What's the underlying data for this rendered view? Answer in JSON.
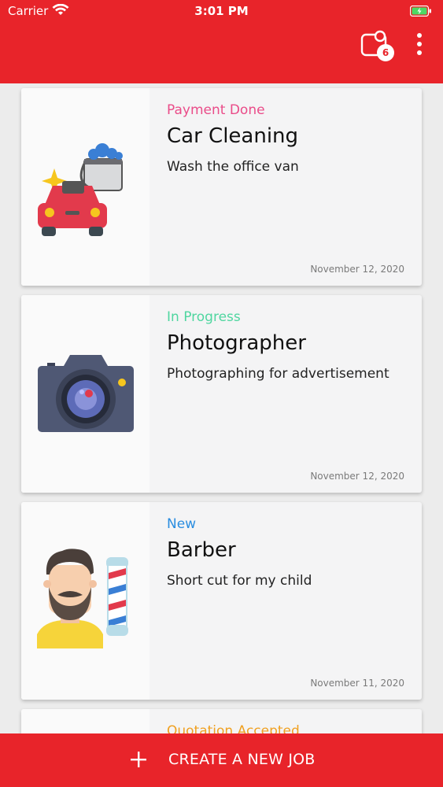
{
  "status_bar": {
    "carrier": "Carrier",
    "time": "3:01 PM"
  },
  "header": {
    "notification_count": "6",
    "icons": [
      "notification-icon",
      "more-vertical-icon"
    ],
    "color": "#e8242a"
  },
  "jobs": [
    {
      "status": "Payment Done",
      "status_color": "#ea4c89",
      "title": "Car Cleaning",
      "description": "Wash the office van",
      "date": "November 12, 2020",
      "icon": "car-wash-icon"
    },
    {
      "status": "In Progress",
      "status_color": "#4fd6a0",
      "title": "Photographer",
      "description": "Photographing for advertisement",
      "date": "November 12, 2020",
      "icon": "camera-icon"
    },
    {
      "status": "New",
      "status_color": "#2a8de0",
      "title": "Barber",
      "description": "Short cut for my child",
      "date": "November 11, 2020",
      "icon": "barber-icon"
    },
    {
      "status": "Quotation Accepted",
      "status_color": "#f0a020",
      "title": "",
      "description": "",
      "date": "",
      "icon": ""
    }
  ],
  "bottom_bar": {
    "label": "CREATE A NEW JOB",
    "icon": "plus-icon"
  }
}
